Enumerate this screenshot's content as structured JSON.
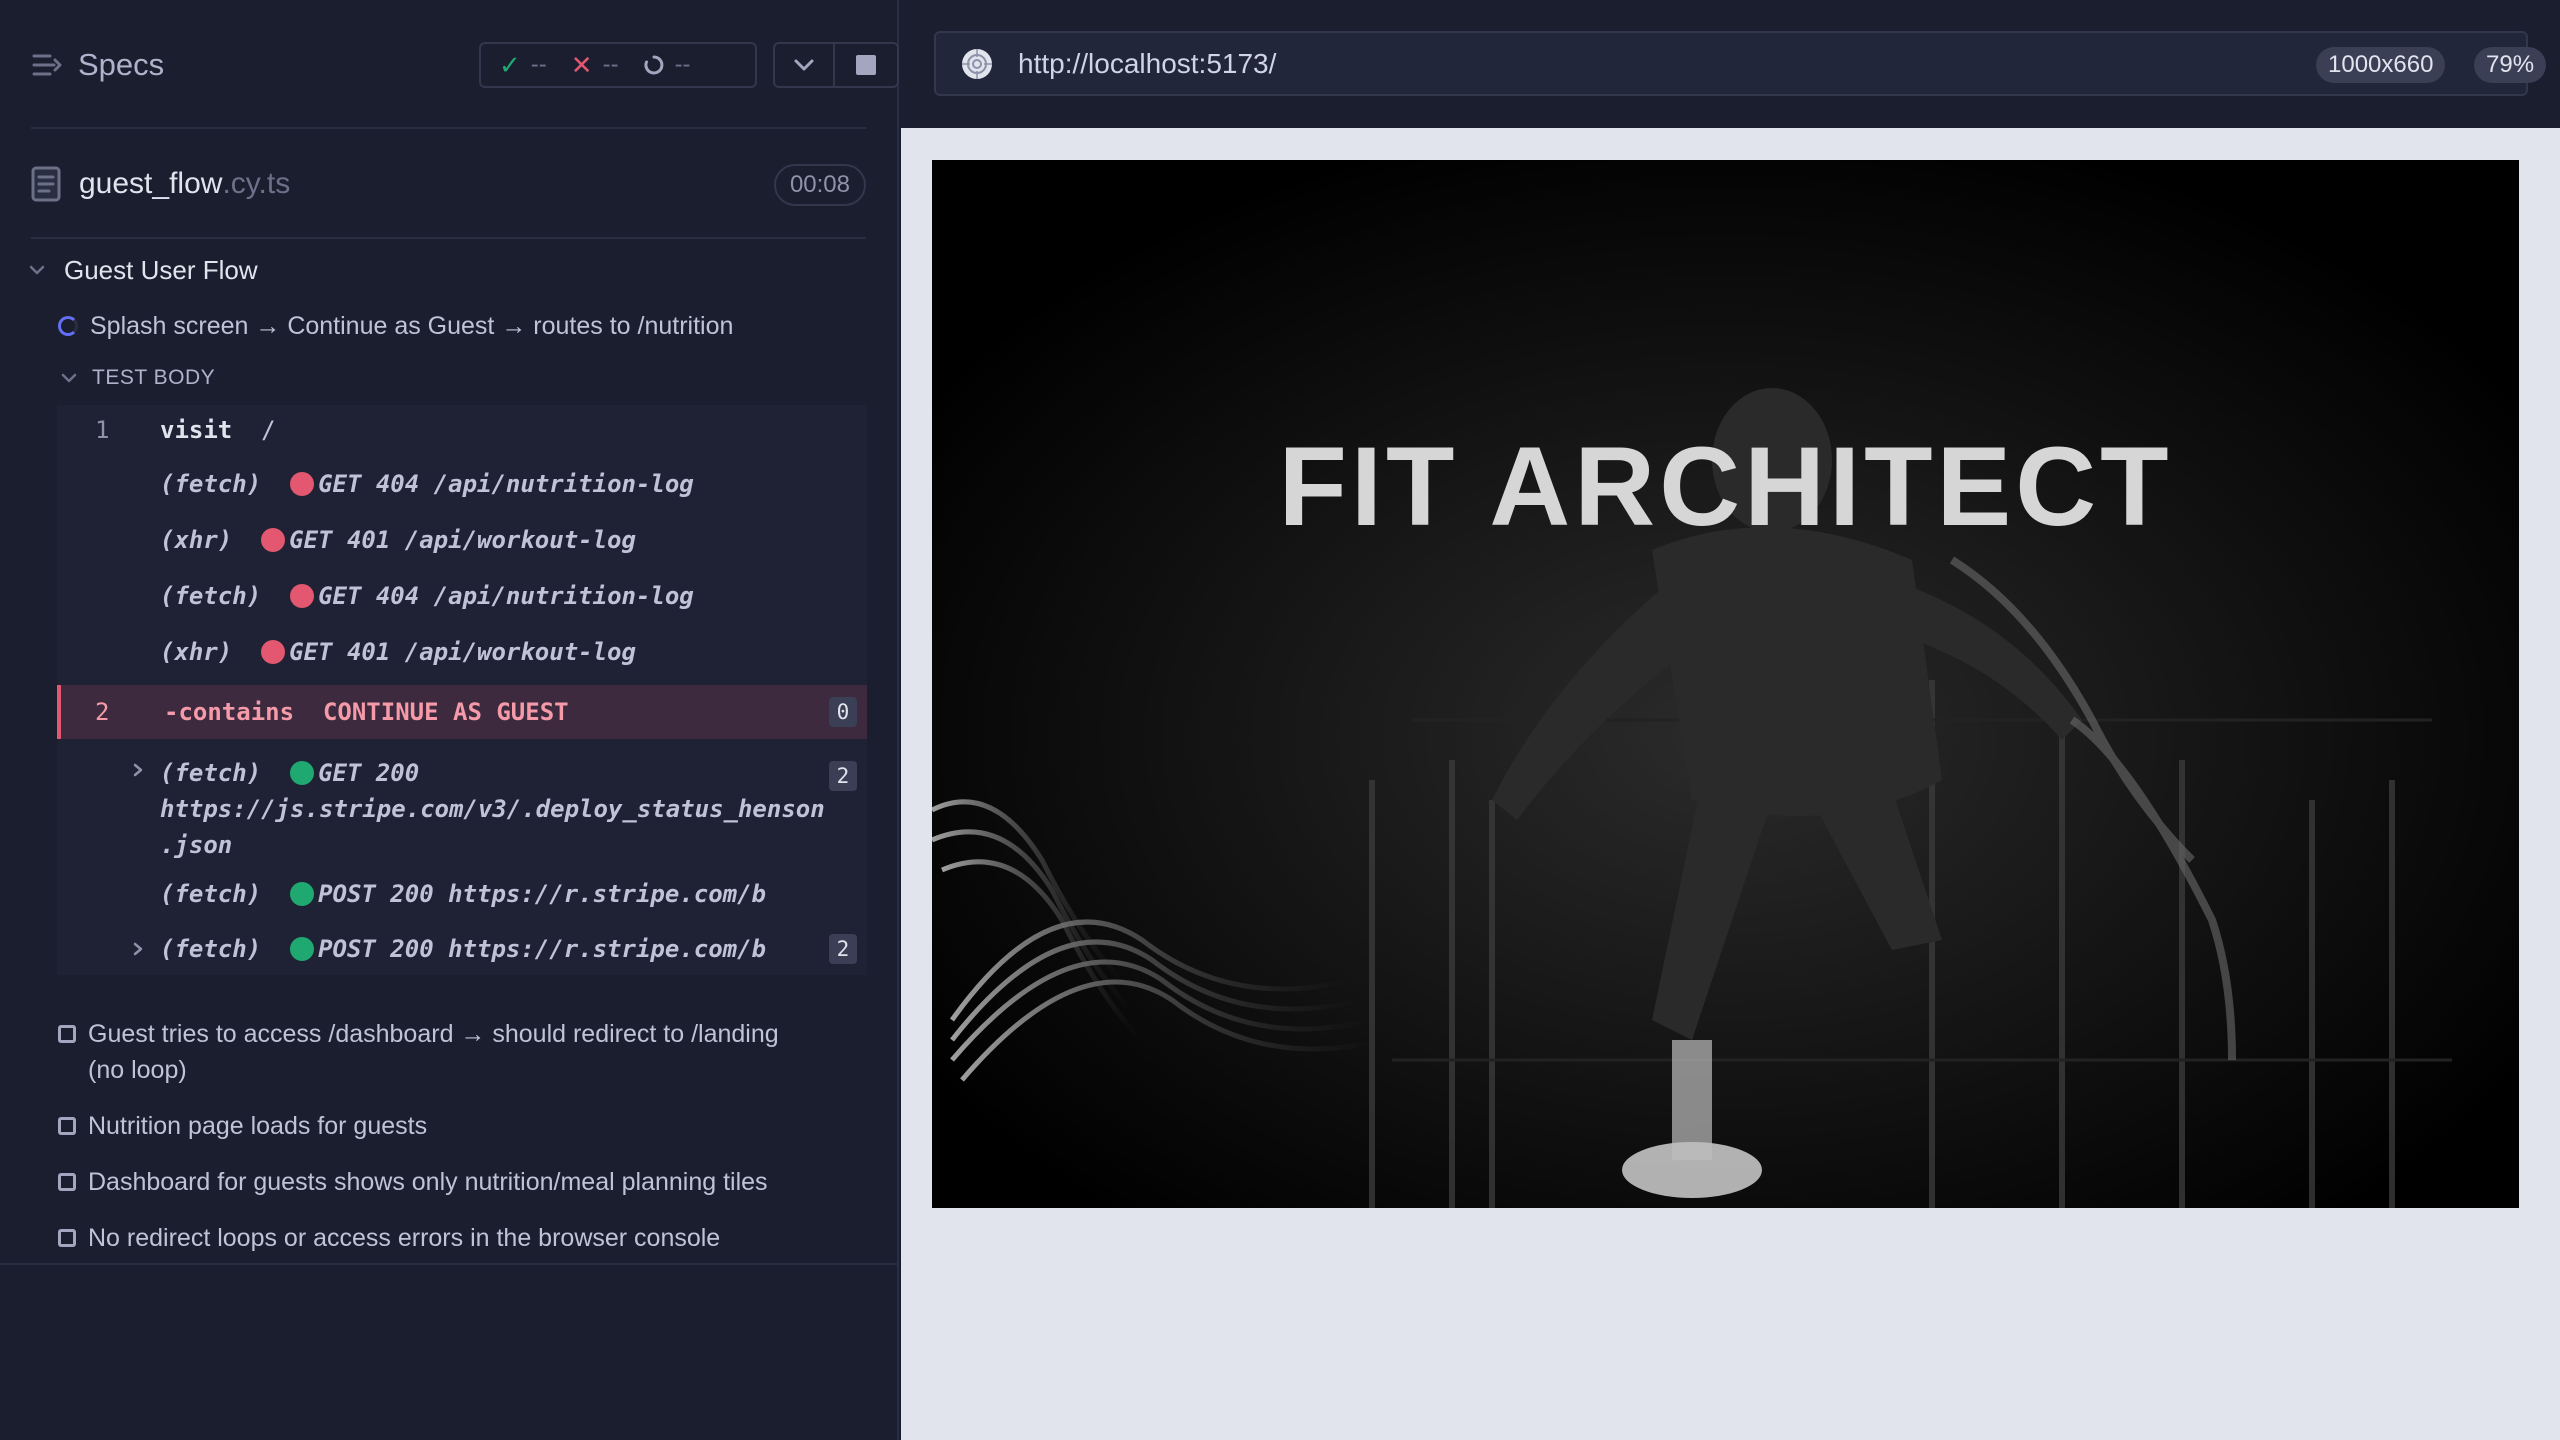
{
  "reporter": {
    "title": "Specs",
    "stats": {
      "passed": "--",
      "failed": "--",
      "pending": "--"
    },
    "file": {
      "name": "guest_flow",
      "ext": ".cy.ts",
      "duration": "00:08"
    },
    "suite": {
      "title": "Guest User Flow"
    },
    "running_test": {
      "title": "Splash screen → Continue as Guest → routes to /nutrition"
    },
    "test_body_label": "TEST BODY",
    "commands": [
      {
        "num": "1",
        "name": "visit",
        "arg": "/"
      },
      {
        "type": "(fetch)",
        "status": "GET 404",
        "url": "/api/nutrition-log"
      },
      {
        "type": "(xhr)",
        "status": "GET 401",
        "url": "/api/workout-log"
      },
      {
        "type": "(fetch)",
        "status": "GET 404",
        "url": "/api/nutrition-log"
      },
      {
        "type": "(xhr)",
        "status": "GET 401",
        "url": "/api/workout-log"
      },
      {
        "num": "2",
        "name": "-contains",
        "arg": "CONTINUE AS GUEST",
        "badge": "0"
      },
      {
        "type": "(fetch)",
        "status": "GET 200",
        "url_line1": "https://js.stripe.com/v3/.deploy_status_henson",
        "url_line2": ".json",
        "badge": "2"
      },
      {
        "type": "(fetch)",
        "status": "POST 200",
        "url": "https://r.stripe.com/b"
      },
      {
        "type": "(fetch)",
        "status": "POST 200",
        "url": "https://r.stripe.com/b",
        "badge": "2"
      }
    ],
    "pending_tests": [
      {
        "line1": "Guest tries to access /dashboard → should redirect to /landing",
        "line2": "(no loop)"
      },
      {
        "line1": "Nutrition page loads for guests"
      },
      {
        "line1": "Dashboard for guests shows only nutrition/meal planning tiles"
      },
      {
        "line1": "No redirect loops or access errors in the browser console"
      }
    ]
  },
  "aut": {
    "url": "http://localhost:5173/",
    "viewport": "1000x660",
    "zoom": "79%",
    "hero_title": "FIT ARCHITECT"
  },
  "colors": {
    "pass": "#1fa971",
    "fail": "#e45770",
    "running": "#6470f3",
    "background": "#1b1e2e"
  },
  "icons": [
    "specs-icon",
    "check-icon",
    "x-icon",
    "spinner-icon",
    "chevron-down-icon",
    "stop-icon",
    "file-icon",
    "chevron-right-icon",
    "globe-icon",
    "checkbox-icon"
  ]
}
